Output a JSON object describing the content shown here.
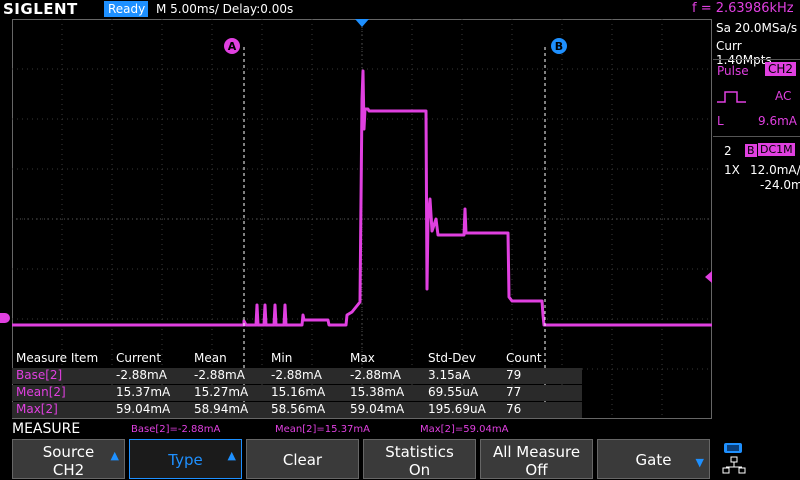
{
  "header": {
    "logo": "SIGLENT",
    "status": "Ready",
    "timebase": "M 5.00ms/ Delay:0.00s",
    "frequency": "f = 2.63986kHz"
  },
  "cursors": {
    "a_label": "A",
    "b_label": "B"
  },
  "right_panel": {
    "sample_rate": "Sa 20.0MSa/s",
    "memory": "Curr 1.40Mpts",
    "trigger_type": "Pulse",
    "trigger_source": "CH2",
    "coupling": "AC",
    "level_label": "L",
    "level_value": "9.6mA",
    "channel_num": "2",
    "bw_badge": "B",
    "channel_coupling": "DC1M",
    "probe": "1X",
    "scale": "12.0mA/",
    "offset": "-24.0mA"
  },
  "measure_table": {
    "headers": [
      "Measure Item",
      "Current",
      "Mean",
      "Min",
      "Max",
      "Std-Dev",
      "Count"
    ],
    "rows": [
      [
        "Base[2]",
        "-2.88mA",
        "-2.88mA",
        "-2.88mA",
        "-2.88mA",
        "3.15aA",
        "79"
      ],
      [
        "Mean[2]",
        "15.37mA",
        "15.27mA",
        "15.16mA",
        "15.38mA",
        "69.55uA",
        "77"
      ],
      [
        "Max[2]",
        "59.04mA",
        "58.94mA",
        "58.56mA",
        "59.04mA",
        "195.69uA",
        "76"
      ]
    ]
  },
  "status_strip": {
    "title": "MEASURE",
    "items": [
      "Base[2]=-2.88mA",
      "Mean[2]=15.37mA",
      "Max[2]=59.04mA"
    ]
  },
  "softkeys": {
    "source_l1": "Source",
    "source_l2": "CH2",
    "type": "Type",
    "clear": "Clear",
    "stats_l1": "Statistics",
    "stats_l2": "On",
    "all_l1": "All Measure",
    "all_l2": "Off",
    "gate": "Gate"
  },
  "waveform": {
    "channel": "CH2",
    "color": "#e040e0",
    "segments_note": ""
  },
  "colors": {
    "accent": "#1e90ff",
    "trace": "#e040e0",
    "cursor": "#ffffff"
  }
}
